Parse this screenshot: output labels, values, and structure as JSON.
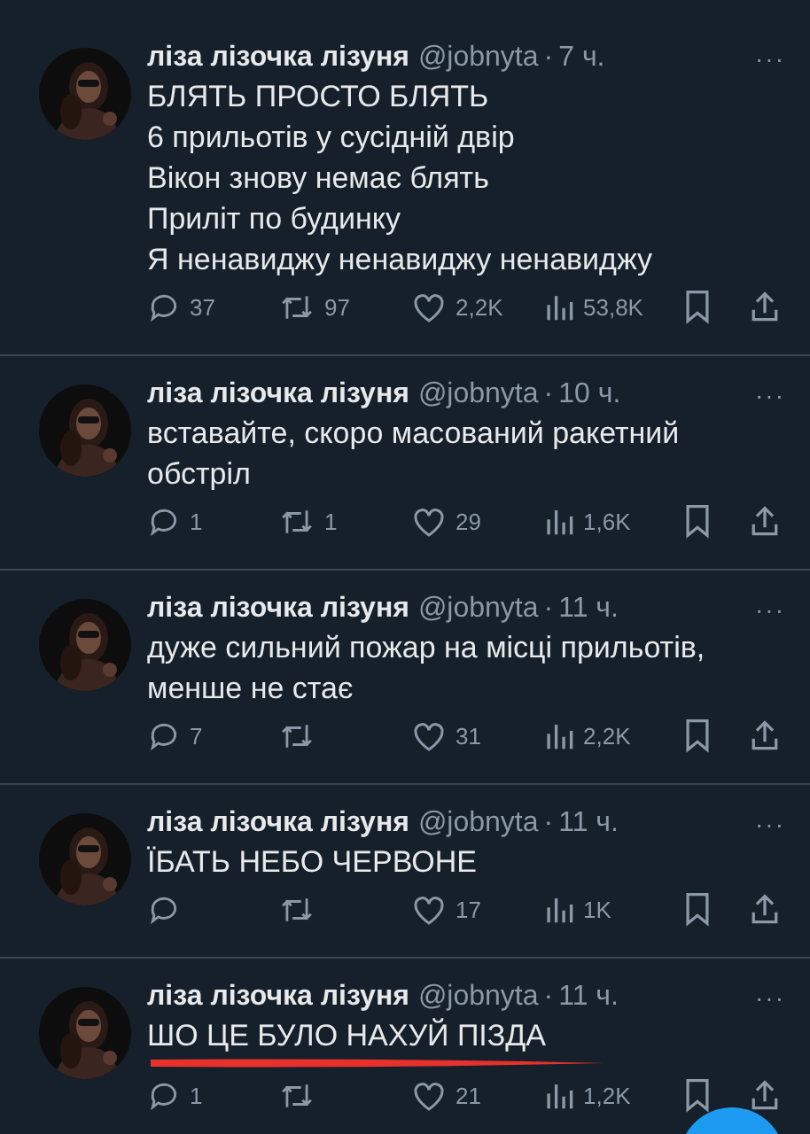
{
  "tweets": [
    {
      "name": "ліза лізочка лізуня",
      "handle": "@jobnyta",
      "sep": "·",
      "time": "7 ч.",
      "more": "···",
      "lines": [
        "БЛЯТЬ ПРОСТО БЛЯТЬ",
        "6 прильотів у сусідній двір",
        "Вікон знову немає блять",
        "Приліт по будинку",
        "Я ненавиджу ненавиджу ненавиджу"
      ],
      "replies": "37",
      "reposts": "97",
      "likes": "2,2K",
      "views": "53,8K",
      "scribbled": false
    },
    {
      "name": "ліза лізочка лізуня",
      "handle": "@jobnyta",
      "sep": "·",
      "time": "10 ч.",
      "more": "···",
      "lines": [
        "вставайте, скоро масований ракетний обстріл"
      ],
      "replies": "1",
      "reposts": "1",
      "likes": "29",
      "views": "1,6K",
      "scribbled": false
    },
    {
      "name": "ліза лізочка лізуня",
      "handle": "@jobnyta",
      "sep": "·",
      "time": "11 ч.",
      "more": "···",
      "lines": [
        "дуже сильний пожар на місці прильотів, менше не стає"
      ],
      "replies": "7",
      "likes": "31",
      "views": "2,2K",
      "scribbled": false
    },
    {
      "name": "ліза лізочка лізуня",
      "handle": "@jobnyta",
      "sep": "·",
      "time": "11 ч.",
      "more": "···",
      "lines": [
        "ЇБАТЬ НЕБО ЧЕРВОНЕ"
      ],
      "likes": "17",
      "views": "1K",
      "scribbled": false
    },
    {
      "name": "ліза лізочка лізуня",
      "handle": "@jobnyta",
      "sep": "·",
      "time": "11 ч.",
      "more": "···",
      "lines": [
        "ШО ЦЕ БУЛО НАХУЙ ПІЗДА"
      ],
      "replies": "1",
      "likes": "21",
      "views": "1,2K",
      "scribbled": true
    }
  ]
}
